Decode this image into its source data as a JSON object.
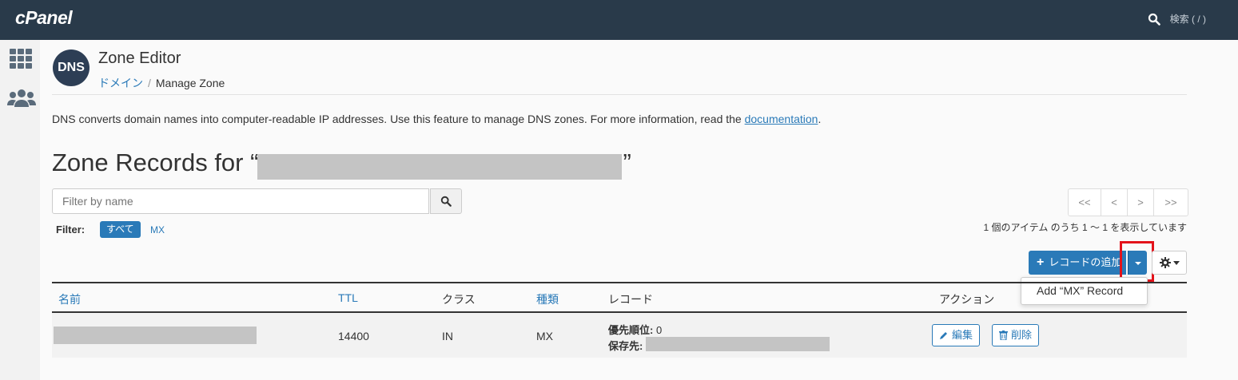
{
  "brand": {
    "logo": "cPanel"
  },
  "search": {
    "label": "検索 ( / )"
  },
  "page": {
    "title": "Zone Editor",
    "breadcrumb": {
      "parent": "ドメイン",
      "separator": "/",
      "current": "Manage Zone"
    },
    "description_prefix": "DNS converts domain names into computer-readable IP addresses. Use this feature to manage DNS zones. For more information, read the ",
    "description_link": "documentation",
    "description_suffix": ".",
    "zone_title_prefix": "Zone Records for “",
    "zone_title_suffix": "”"
  },
  "filter": {
    "placeholder": "Filter by name",
    "label": "Filter:",
    "options": [
      "すべて",
      "MX"
    ]
  },
  "pagination": {
    "buttons": [
      "<<",
      "<",
      ">",
      ">>"
    ],
    "info": "1 個のアイテム のうち 1 ～ 1 を表示しています"
  },
  "actions": {
    "add_record_label": "レコードの追加",
    "dropdown_item": "Add “MX” Record"
  },
  "table": {
    "headers": {
      "name": "名前",
      "ttl": "TTL",
      "class": "クラス",
      "type": "種類",
      "record": "レコード",
      "actions": "アクション"
    },
    "rows": [
      {
        "ttl": "14400",
        "class": "IN",
        "type": "MX",
        "priority_label": "優先順位:",
        "priority": "0",
        "destination_label": "保存先:",
        "edit_label": "編集",
        "delete_label": "削除"
      }
    ]
  },
  "colors": {
    "topbar": "#293a4a",
    "accent": "#2a7ab8",
    "highlight": "#e3131b"
  },
  "icons": [
    "search-icon",
    "grid-icon",
    "users-icon",
    "dns-icon",
    "plus-icon",
    "caret-down-icon",
    "gear-icon",
    "pencil-icon",
    "trash-icon"
  ]
}
